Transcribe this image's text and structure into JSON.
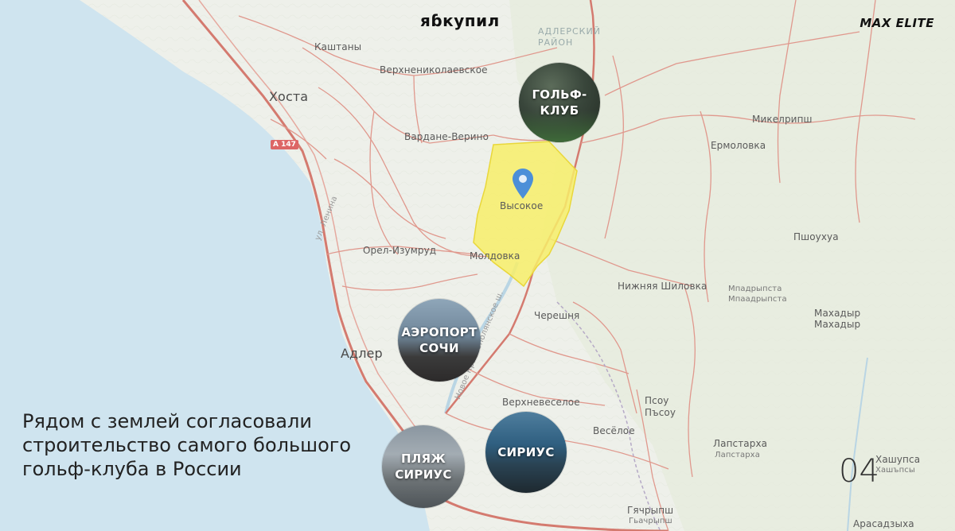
{
  "header": {
    "logo_text": "яɓкупил",
    "brand_text": "MAX ELITE"
  },
  "map": {
    "labels": {
      "kashtany": "Каштаны",
      "verkhnenikolaevskoe": "Верхнениколаевское",
      "khosta": "Хоста",
      "vardane_verino": "Вардане-Верино",
      "vysokoe": "Высокое",
      "orel_izumrud": "Орел-Изумруд",
      "moldovka": "Молдовка",
      "mikelripsh": "Микелрипш",
      "ermolovka": "Ермоловка",
      "pshoukhua": "Пшоухуа",
      "nizhnyaya_shilovka": "Нижняя Шиловка",
      "mpadrypsta": "Мпадрыпста",
      "mpaadrypsta": "Мпаадрыпста",
      "makhadyr": "Махадыр",
      "makhadyr_sub": "Махадыр",
      "chereshnya": "Черешня",
      "adler": "Адлер",
      "verkhneveseloe": "Верхневеселое",
      "psou": "Псоу",
      "psou_sub": "Пъсоу",
      "veseloe": "Весёлое",
      "lapstarkha": "Лапстарха",
      "lapstarkha_sub": "Лапстарха",
      "khashupsa": "Хашупса",
      "khashupsa_sub": "Хашъпсы",
      "gyachrypsh": "Гячрыпш",
      "gyachrypsh_sub": "Гьачрыпш",
      "arasadzykha": "Арасадзыха",
      "adler_district": "АДЛЕРСКИЙ РАЙОН",
      "ul_lenina": "ул. Ленина",
      "novoe_krasnopolyanskoe": "Новое Краснополянское ш.",
      "road_a147": "А 147"
    }
  },
  "circles": {
    "golf": "ГОЛЬФ-КЛУБ",
    "airport": "АЭРОПОРТ СОЧИ",
    "beach": "ПЛЯЖ СИРИУС",
    "sirius": "СИРИУС"
  },
  "headline": "Рядом с землей согласовали строительство самого большого гольф-клуба в России",
  "page_number": "04",
  "colors": {
    "sea": "#cfe4ef",
    "land": "#eef0ea",
    "road": "#d47a6f",
    "plot_fill": "#f7ef6a",
    "pin": "#4c8fd8"
  }
}
